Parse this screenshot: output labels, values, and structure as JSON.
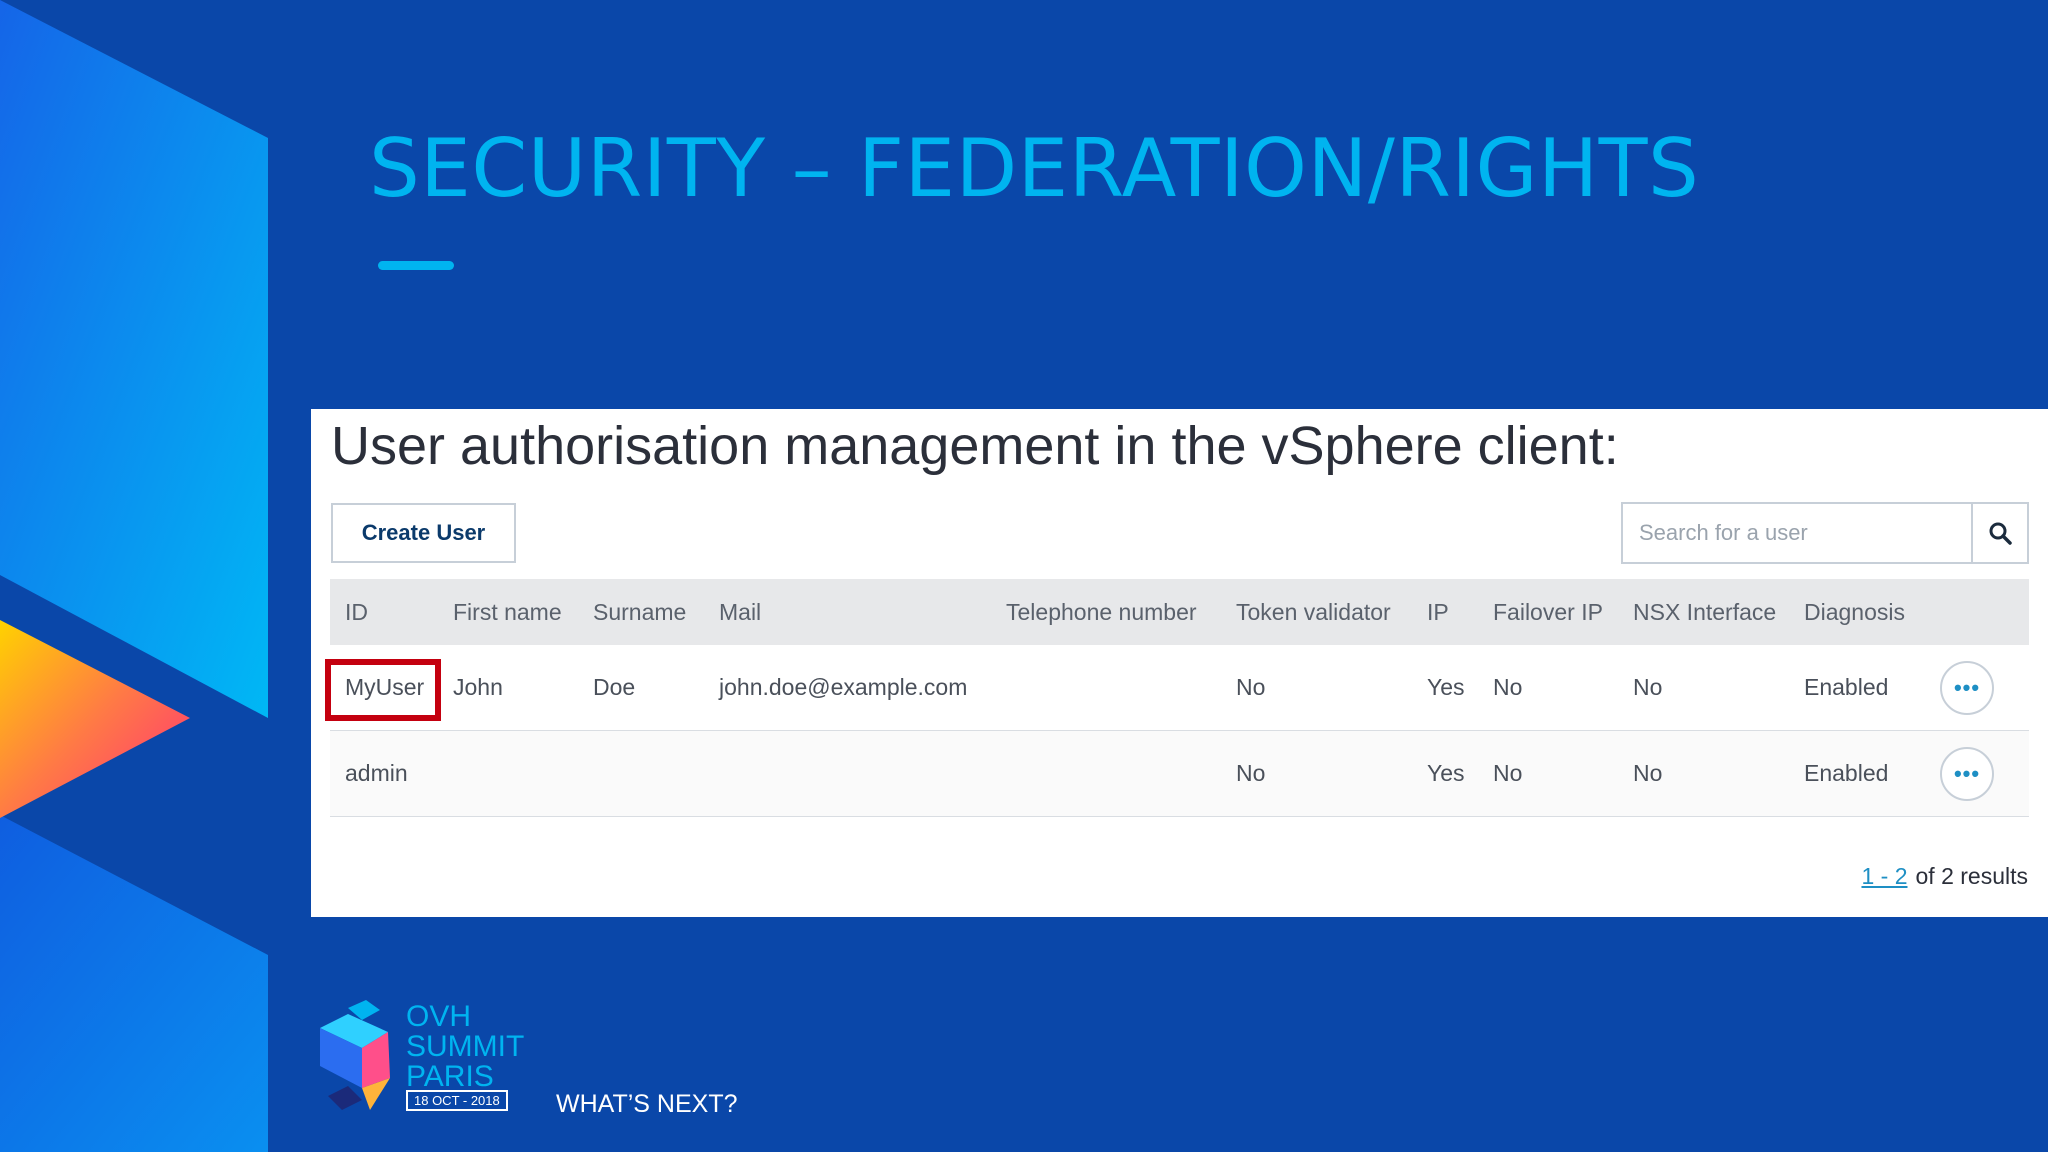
{
  "slide": {
    "title": "SECURITY – FEDERATION/RIGHTS",
    "tagline": "WHAT’S NEXT?",
    "logo": {
      "line1": "OVH",
      "line2": "SUMMIT",
      "line3": "PARIS",
      "date": "18 OCT - 2018"
    }
  },
  "panel": {
    "heading": "User authorisation management in the vSphere client:",
    "create_label": "Create User",
    "search": {
      "placeholder": "Search for a user",
      "icon": "search-icon"
    },
    "columns": [
      "ID",
      "First name",
      "Surname",
      "Mail",
      "Telephone number",
      "Token validator",
      "IP",
      "Failover IP",
      "NSX Interface",
      "Diagnosis"
    ],
    "rows": [
      {
        "id": "MyUser",
        "first": "John",
        "surname": "Doe",
        "mail": "john.doe@example.com",
        "tel": "",
        "token": "No",
        "ip": "Yes",
        "failover": "No",
        "nsx": "No",
        "diag": "Enabled",
        "action": "•••"
      },
      {
        "id": "admin",
        "first": "",
        "surname": "",
        "mail": "",
        "tel": "",
        "token": "No",
        "ip": "Yes",
        "failover": "No",
        "nsx": "No",
        "diag": "Enabled",
        "action": "•••"
      }
    ],
    "pager": {
      "range": "1 - 2",
      "suffix": "of 2 results"
    }
  },
  "colors": {
    "background": "#0a47a9",
    "title": "#00b4f0",
    "highlight": "#c4000f",
    "link": "#1e8fc4"
  }
}
